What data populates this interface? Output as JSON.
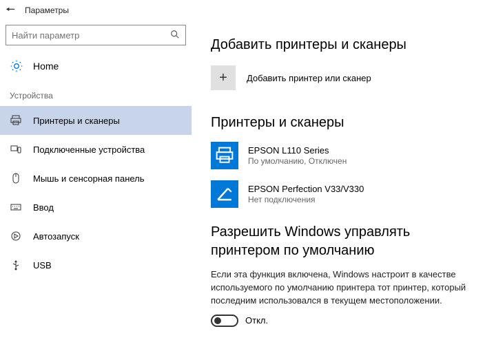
{
  "titlebar": {
    "title": "Параметры"
  },
  "search": {
    "placeholder": "Найти параметр"
  },
  "home_label": "Home",
  "group_header": "Устройства",
  "nav": [
    {
      "label": "Принтеры и сканеры",
      "icon": "printer-icon"
    },
    {
      "label": "Подключенные устройства",
      "icon": "devices-icon"
    },
    {
      "label": "Мышь и сенсорная панель",
      "icon": "mouse-icon"
    },
    {
      "label": "Ввод",
      "icon": "keyboard-icon"
    },
    {
      "label": "Автозапуск",
      "icon": "autoplay-icon"
    },
    {
      "label": "USB",
      "icon": "usb-icon"
    }
  ],
  "add_section": {
    "heading": "Добавить принтеры и сканеры",
    "action": "Добавить принтер или сканер"
  },
  "list_section": {
    "heading": "Принтеры и сканеры",
    "devices": [
      {
        "name": "EPSON L110 Series",
        "status": "По умолчанию, Отключен",
        "kind": "printer"
      },
      {
        "name": "EPSON Perfection V33/V330",
        "status": "Нет подключения",
        "kind": "scanner"
      }
    ]
  },
  "manage_section": {
    "heading": "Разрешить Windows управлять принтером по умолчанию",
    "description": "Если эта функция включена, Windows настроит в качестве используемого по умолчанию принтера тот принтер, который последним использовался в текущем местоположении.",
    "toggle_label": "Откл."
  }
}
